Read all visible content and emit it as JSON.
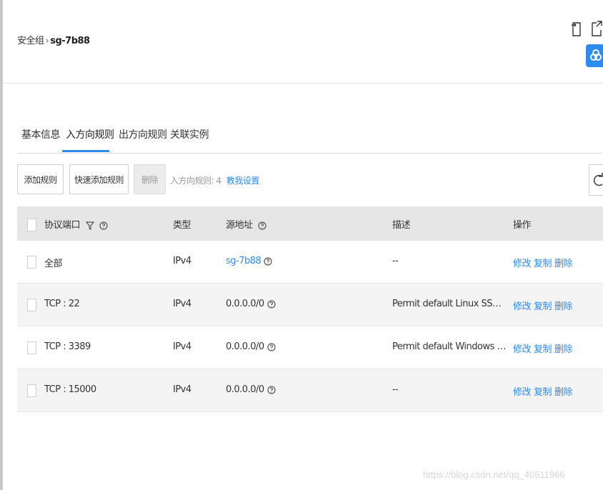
{
  "breadcrumb": {
    "parent": "安全组",
    "separator": "›",
    "current": "sg-7b88"
  },
  "tabs": [
    {
      "label": "基本信息",
      "active": false
    },
    {
      "label": "入方向规则",
      "active": true
    },
    {
      "label": "出方向规则",
      "active": false
    },
    {
      "label": "关联实例",
      "active": false
    }
  ],
  "toolbar": {
    "add_rule": "添加规则",
    "quick_add_rule": "快速添加规则",
    "delete": "删除",
    "rule_count_label": "入方向规则:",
    "rule_count": "4",
    "tutorial_link": "教我设置"
  },
  "table": {
    "headers": {
      "protocol_port": "协议端口",
      "type": "类型",
      "source": "源地址",
      "description": "描述",
      "actions": "操作"
    },
    "rows": [
      {
        "protocol_port": "全部",
        "type": "IPv4",
        "source": "sg-7b88",
        "source_is_link": true,
        "description": "--"
      },
      {
        "protocol_port": "TCP : 22",
        "type": "IPv4",
        "source": "0.0.0.0/0",
        "source_is_link": false,
        "description": "Permit default Linux SSH port."
      },
      {
        "protocol_port": "TCP : 3389",
        "type": "IPv4",
        "source": "0.0.0.0/0",
        "source_is_link": false,
        "description": "Permit default Windows remote des..."
      },
      {
        "protocol_port": "TCP : 15000",
        "type": "IPv4",
        "source": "0.0.0.0/0",
        "source_is_link": false,
        "description": "--"
      }
    ],
    "row_actions": {
      "modify": "修改",
      "copy": "复制",
      "delete": "删除"
    }
  },
  "watermark": "https://blog.csdn.net/qq_40511966",
  "colors": {
    "accent": "#2e8bf0",
    "header_bg": "#e6e6e6",
    "row_alt_bg": "#f4f4f4"
  },
  "icons": [
    "export-icon",
    "open-new-window-icon",
    "assistant-icon",
    "filter-icon",
    "help-icon",
    "refresh-icon"
  ]
}
